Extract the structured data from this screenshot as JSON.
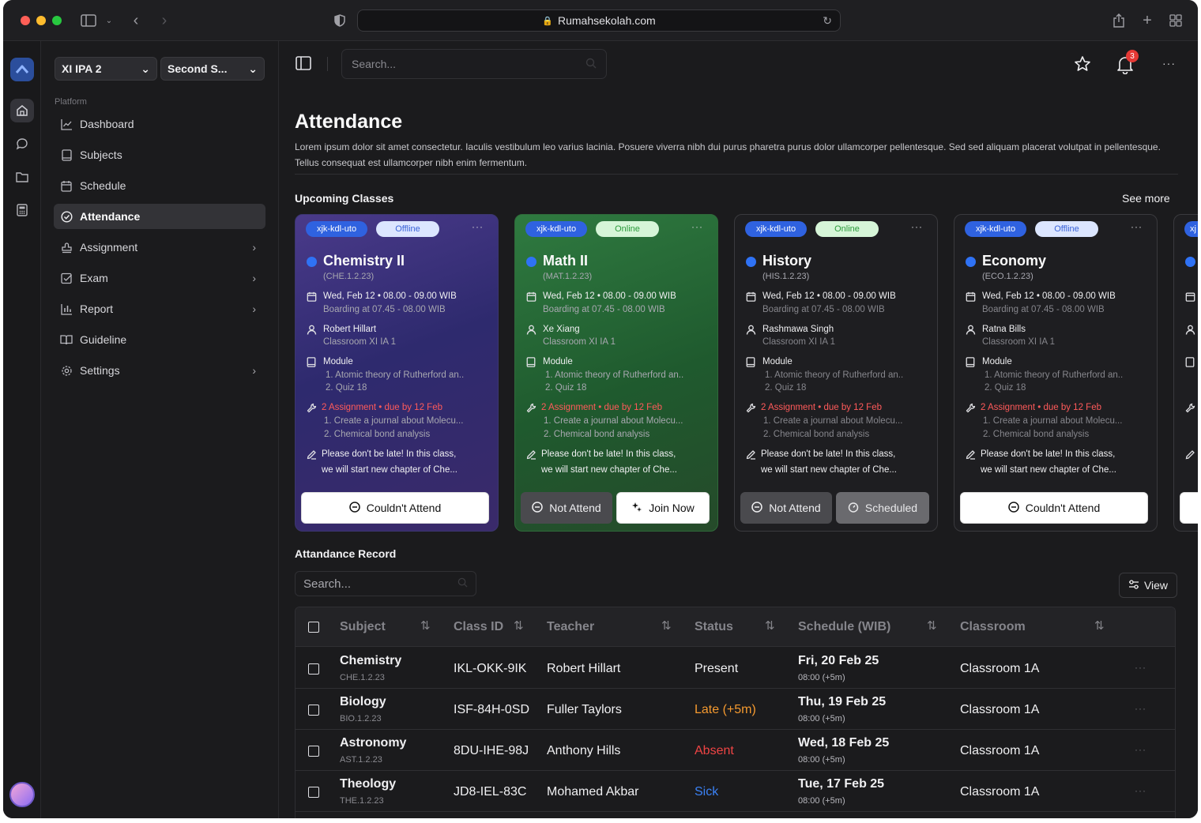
{
  "browser": {
    "url": "Rumahsekolah.com"
  },
  "sidebar": {
    "class_select": "XI IPA 2",
    "semester_select": "Second S...",
    "section_label": "Platform",
    "items": [
      {
        "label": "Dashboard"
      },
      {
        "label": "Subjects"
      },
      {
        "label": "Schedule"
      },
      {
        "label": "Attendance"
      },
      {
        "label": "Assignment"
      },
      {
        "label": "Exam"
      },
      {
        "label": "Report"
      },
      {
        "label": "Guideline"
      },
      {
        "label": "Settings"
      }
    ]
  },
  "topbar": {
    "search_placeholder": "Search...",
    "notification_count": "3"
  },
  "page": {
    "title": "Attendance",
    "description": "Lorem ipsum dolor sit amet consectetur. Iaculis vestibulum leo varius lacinia. Posuere viverra nibh dui purus pharetra purus dolor ullamcorper pellentesque. Sed sed aliquam placerat volutpat in pellentesque. Tellus consequat est ullamcorper nibh enim fermentum."
  },
  "upcoming": {
    "title": "Upcoming Classes",
    "see_more": "See more",
    "cards": [
      {
        "id_tag": "xjk-kdl-uto",
        "mode": "Offline",
        "name": "Chemistry II",
        "code": "(CHE.1.2.23)",
        "schedule": "Wed, Feb 12 • 08.00 - 09.00 WIB",
        "boarding": "Boarding at 07.45 - 08.00 WIB",
        "teacher": "Robert Hillart",
        "classroom": "Classroom XI IA 1",
        "module_label": "Module",
        "module_1": "1. Atomic theory of Rutherford an..",
        "module_2": "2. Quiz 18",
        "assignment_label": "2 Assignment • due by 12 Feb",
        "assignment_1": "1. Create a journal about Molecu...",
        "assignment_2": "2. Chemical bond analysis",
        "note_1": "Please don't be late! In this class,",
        "note_2": "we will start new chapter of Che...",
        "btn_1": "Couldn't Attend"
      },
      {
        "id_tag": "xjk-kdl-uto",
        "mode": "Online",
        "name": "Math II",
        "code": "(MAT.1.2.23)",
        "schedule": "Wed, Feb 12 • 08.00 - 09.00 WIB",
        "boarding": "Boarding at 07.45 - 08.00 WIB",
        "teacher": "Xe Xiang",
        "classroom": "Classroom XI IA 1",
        "module_label": "Module",
        "module_1": "1. Atomic theory of Rutherford an..",
        "module_2": "2. Quiz 18",
        "assignment_label": "2 Assignment • due by 12 Feb",
        "assignment_1": "1. Create a journal about Molecu...",
        "assignment_2": "2. Chemical bond analysis",
        "note_1": "Please don't be late! In this class,",
        "note_2": "we will start new chapter of Che...",
        "btn_1": "Not Attend",
        "btn_2": "Join Now"
      },
      {
        "id_tag": "xjk-kdl-uto",
        "mode": "Online",
        "name": "History",
        "code": "(HIS.1.2.23)",
        "schedule": "Wed, Feb 12 • 08.00 - 09.00 WIB",
        "boarding": "Boarding at 07.45 - 08.00 WIB",
        "teacher": "Rashmawa Singh",
        "classroom": "Classroom XI IA 1",
        "module_label": "Module",
        "module_1": "1. Atomic theory of Rutherford an..",
        "module_2": "2. Quiz 18",
        "assignment_label": "2 Assignment • due by 12 Feb",
        "assignment_1": "1. Create a journal about Molecu...",
        "assignment_2": "2. Chemical bond analysis",
        "note_1": "Please don't be late! In this class,",
        "note_2": "we will start new chapter of Che...",
        "btn_1": "Not Attend",
        "btn_2": "Scheduled"
      },
      {
        "id_tag": "xjk-kdl-uto",
        "mode": "Offline",
        "name": "Economy",
        "code": "(ECO.1.2.23)",
        "schedule": "Wed, Feb 12 • 08.00 - 09.00 WIB",
        "boarding": "Boarding at 07.45 - 08.00 WIB",
        "teacher": "Ratna Bills",
        "classroom": "Classroom XI IA 1",
        "module_label": "Module",
        "module_1": "1. Atomic theory of Rutherford an..",
        "module_2": "2. Quiz 18",
        "assignment_label": "2 Assignment • due by 12 Feb",
        "assignment_1": "1. Create a journal about Molecu...",
        "assignment_2": "2. Chemical bond analysis",
        "note_1": "Please don't be late! In this class,",
        "note_2": "we will start new chapter of Che...",
        "btn_1": "Couldn't Attend"
      },
      {
        "id_tag": "xj"
      }
    ]
  },
  "record": {
    "title": "Attandance Record",
    "search_placeholder": "Search...",
    "view_label": "View",
    "columns": [
      "Subject",
      "Class ID",
      "Teacher",
      "Status",
      "Schedule (WIB)",
      "Classroom"
    ],
    "rows": [
      {
        "subject": "Chemistry",
        "code": "CHE.1.2.23",
        "class_id": "IKL-OKK-9IK",
        "teacher": "Robert Hillart",
        "status": "Present",
        "date": "Fri, 20 Feb 25",
        "time": "08:00 (+5m)",
        "classroom": "Classroom 1A"
      },
      {
        "subject": "Biology",
        "code": "BIO.1.2.23",
        "class_id": "ISF-84H-0SD",
        "teacher": "Fuller Taylors",
        "status": "Late (+5m)",
        "date": "Thu, 19 Feb 25",
        "time": "08:00 (+5m)",
        "classroom": "Classroom 1A"
      },
      {
        "subject": "Astronomy",
        "code": "AST.1.2.23",
        "class_id": "8DU-IHE-98J",
        "teacher": "Anthony Hills",
        "status": "Absent",
        "date": "Wed, 18 Feb 25",
        "time": "08:00 (+5m)",
        "classroom": "Classroom 1A"
      },
      {
        "subject": "Theology",
        "code": "THE.1.2.23",
        "class_id": "JD8-IEL-83C",
        "teacher": "Mohamed Akbar",
        "status": "Sick",
        "date": "Tue, 17 Feb 25",
        "time": "08:00 (+5m)",
        "classroom": "Classroom 1A"
      }
    ]
  },
  "colors": {
    "present": "#f0f0f2",
    "late": "#f59a2f",
    "absent": "#ef4444",
    "sick": "#3b82f6",
    "accent_blue": "#2f72f5"
  }
}
